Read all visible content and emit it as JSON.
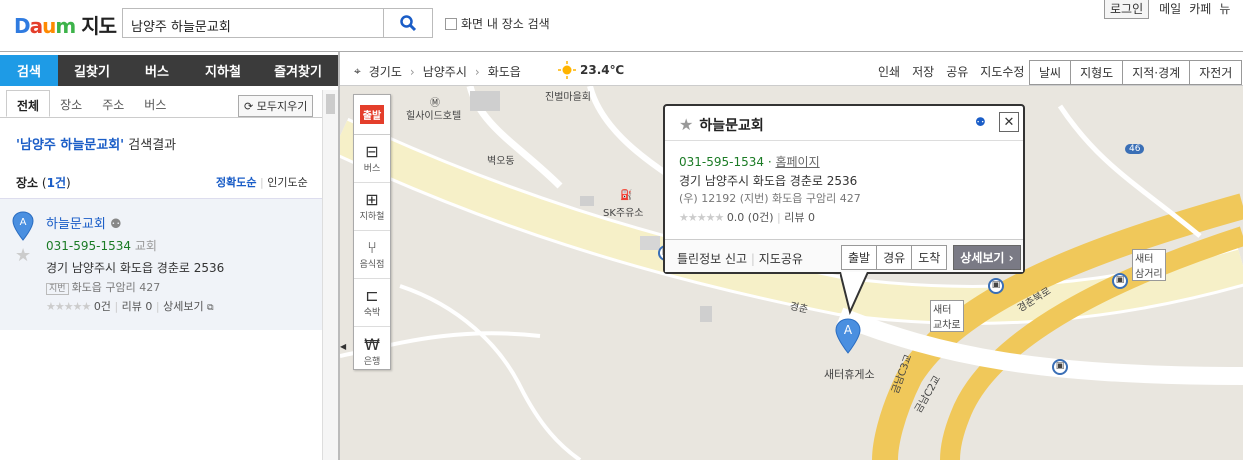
{
  "header": {
    "logo": "Daum",
    "logo_sub": "지도",
    "search_value": "남양주 하늘문교회",
    "checkbox_label": "화면 내 장소 검색",
    "links": {
      "login": "로그인",
      "mail": "메일",
      "cafe": "카페",
      "more": "뉴"
    }
  },
  "nav": {
    "tabs": [
      {
        "label": "검색",
        "active": true
      },
      {
        "label": "길찾기"
      },
      {
        "label": "버스"
      },
      {
        "label": "지하철"
      },
      {
        "label": "즐겨찾기"
      }
    ]
  },
  "subtabs": {
    "items": [
      "전체",
      "장소",
      "주소",
      "버스"
    ],
    "clear": "모두지우기"
  },
  "results": {
    "query": "'남양주 하늘문교회'",
    "suffix": " 검색결과",
    "place_label": "장소",
    "count_open": " (",
    "count": "1건",
    "count_close": ")",
    "sort_accuracy": "정확도순",
    "sort_popular": "인기도순"
  },
  "item": {
    "name": "하늘문교회",
    "phone": "031-595-1534",
    "category": "교회",
    "address": "경기 남양주시 화도읍 경춘로 2536",
    "jibun_tag": "지번",
    "jibun": "화도읍 구암리 427",
    "count": "0건",
    "review": "리뷰 0",
    "detail": "상세보기"
  },
  "mapbar": {
    "region": [
      "경기도",
      "남양주시",
      "화도읍"
    ],
    "temp": "23.4℃",
    "links": [
      "인쇄",
      "저장",
      "공유",
      "지도수정"
    ],
    "tabs": [
      "날씨",
      "지형도",
      "지적·경계",
      "자전거"
    ]
  },
  "tools": {
    "depart": "출발",
    "items": [
      {
        "icon": "bus-icon",
        "label": "버스"
      },
      {
        "icon": "subway-icon",
        "label": "지하철"
      },
      {
        "icon": "restaurant-icon",
        "label": "음식점"
      },
      {
        "icon": "lodging-icon",
        "label": "숙박"
      },
      {
        "icon": "bank-icon",
        "label": "은행"
      }
    ]
  },
  "popup": {
    "title": "하늘문교회",
    "phone": "031-595-1534",
    "homepage": "홈페이지",
    "address": "경기 남양주시 화도읍 경춘로 2536",
    "jibun": "(우) 12192 (지번) 화도읍 구암리 427",
    "rating": "0.0 (0건)",
    "review": "리뷰 0",
    "report": "틀린정보 신고",
    "share": "지도공유",
    "buttons": [
      "출발",
      "경유",
      "도착"
    ],
    "more": "상세보기"
  },
  "map_labels": {
    "hotel": "힐사이드호텔",
    "village": "진벌마을회",
    "byeokodong": "벽오동",
    "sk": "SK주유소",
    "marker": "A",
    "place": "새터휴게소",
    "route": "46",
    "setter": "새터",
    "setter_jct": "교차로",
    "setter3": "새터",
    "setter3b": "삼거리",
    "road1": "경춘북로",
    "road2": "금남C3교",
    "road3": "금남C2교",
    "road4": "경춘"
  }
}
